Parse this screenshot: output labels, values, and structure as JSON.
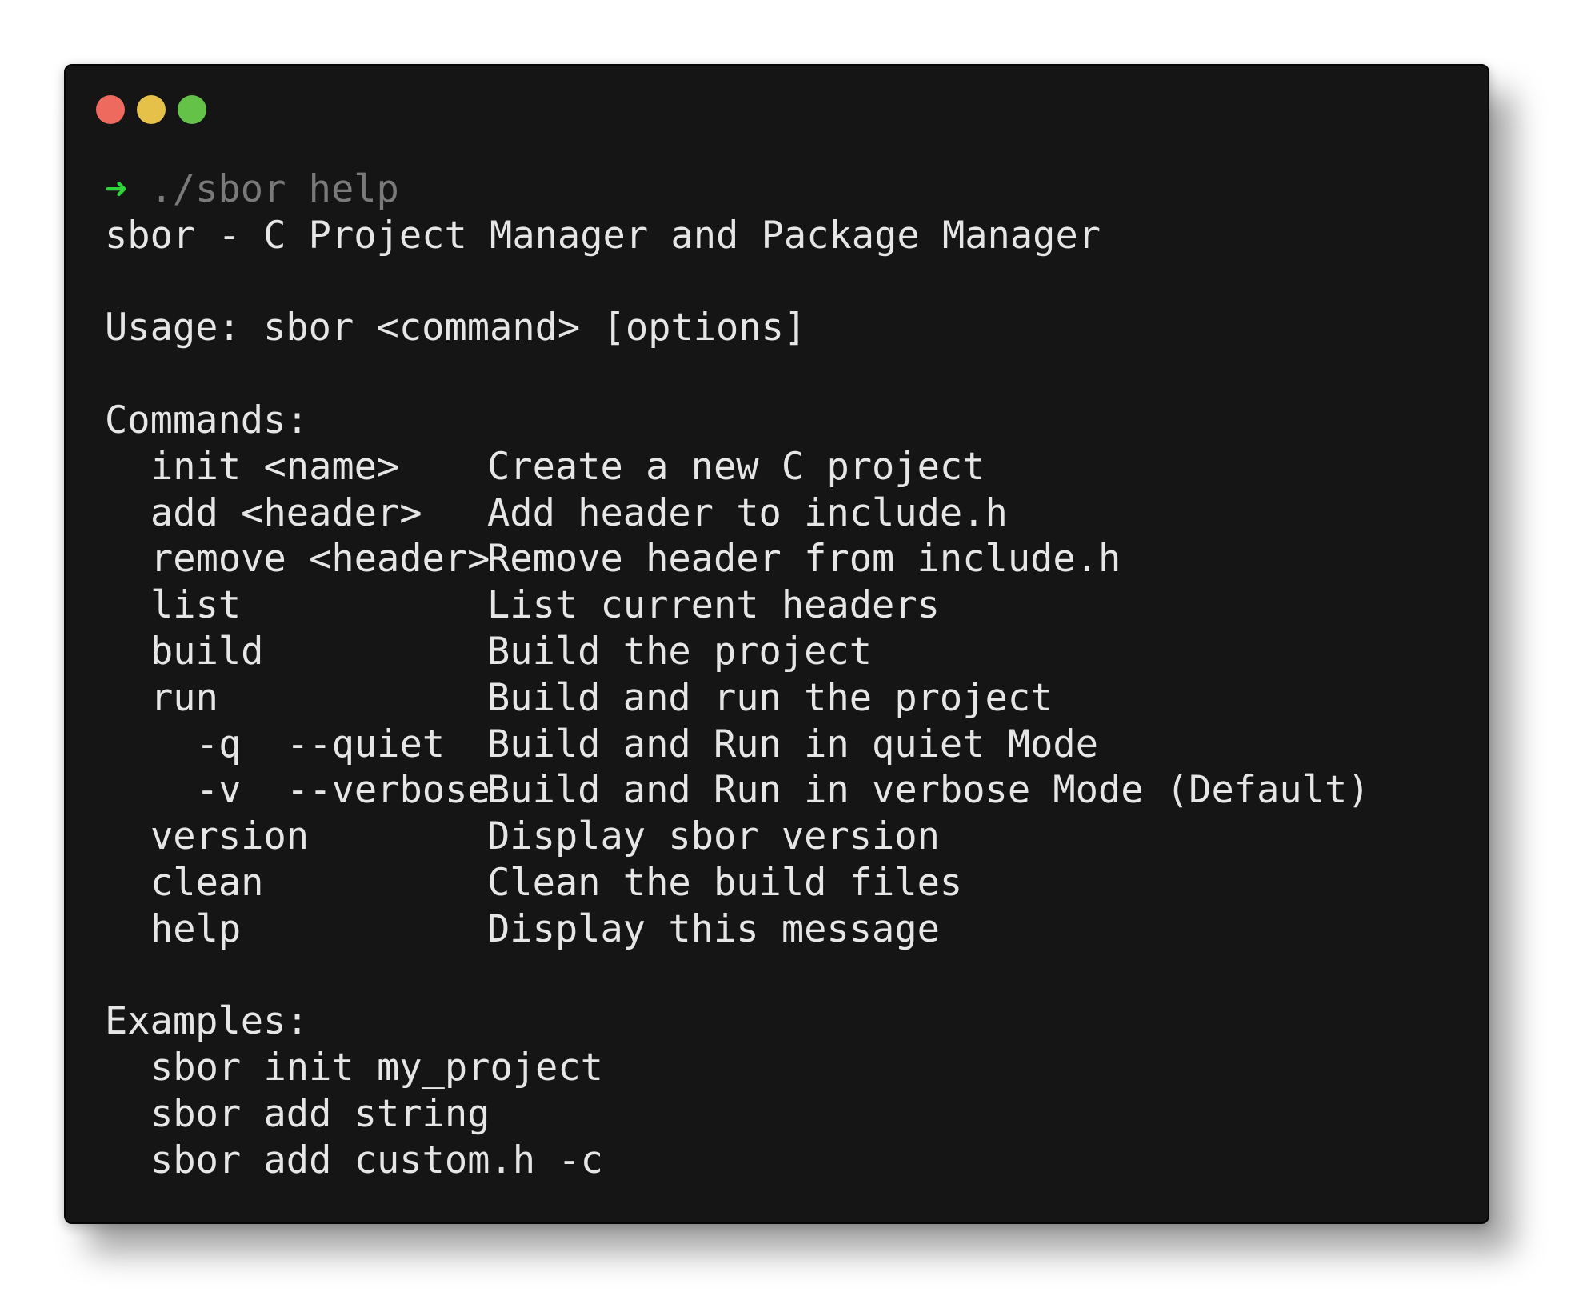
{
  "window": {
    "buttons": {
      "close_color": "#ee6a5e",
      "minimize_color": "#e6c14a",
      "maximize_color": "#64c249"
    }
  },
  "prompt": {
    "arrow": "➜",
    "command": "./sbor help",
    "arrow_color": "#2fd33a"
  },
  "output": {
    "title": "sbor - C Project Manager and Package Manager",
    "usage": "Usage: sbor <command> [options]",
    "commands_header": "Commands:",
    "commands": [
      {
        "name": "init <name>",
        "desc": "Create a new C project"
      },
      {
        "name": "add <header>",
        "desc": "Add header to include.h"
      },
      {
        "name": "remove <header>",
        "desc": "Remove header from include.h"
      },
      {
        "name": "list",
        "desc": "List current headers"
      },
      {
        "name": "build",
        "desc": "Build the project"
      },
      {
        "name": "run",
        "desc": "Build and run the project"
      }
    ],
    "run_options": [
      {
        "short": "-q",
        "long": "--quiet",
        "desc": "Build and Run in quiet Mode"
      },
      {
        "short": "-v",
        "long": "--verbose",
        "desc": "Build and Run in verbose Mode (Default)"
      }
    ],
    "commands_after": [
      {
        "name": "version",
        "desc": "Display sbor version"
      },
      {
        "name": "clean",
        "desc": "Clean the build files"
      },
      {
        "name": "help",
        "desc": "Display this message"
      }
    ],
    "examples_header": "Examples:",
    "examples": [
      "sbor init my_project",
      "sbor add string",
      "sbor add custom.h -c"
    ]
  }
}
